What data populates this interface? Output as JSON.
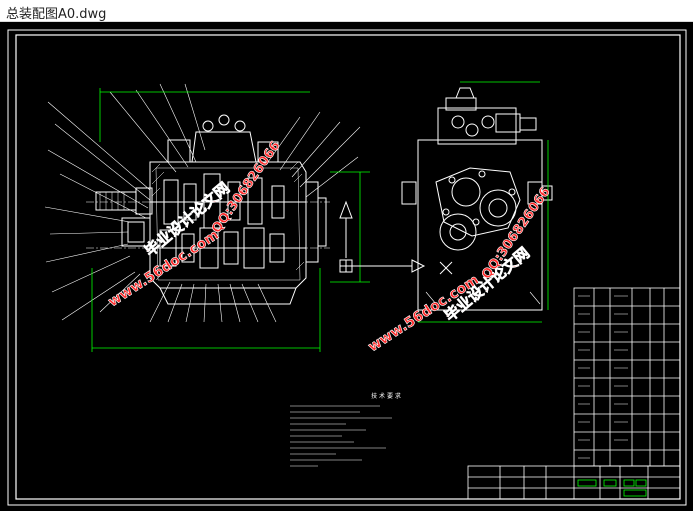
{
  "window": {
    "title": "总装配图A0.dwg"
  },
  "colors": {
    "background": "#000000",
    "white_lines": "#ffffff",
    "green_lines": "#00ff00",
    "watermark": "#ff2a2a",
    "watermark_outline": "#ffffff"
  },
  "drawing": {
    "notes_heading": "技 术 要 求",
    "watermarks": {
      "site": "www.56doc.com",
      "qq": "QQ:306826066",
      "brand": "毕业设计论文网"
    }
  }
}
